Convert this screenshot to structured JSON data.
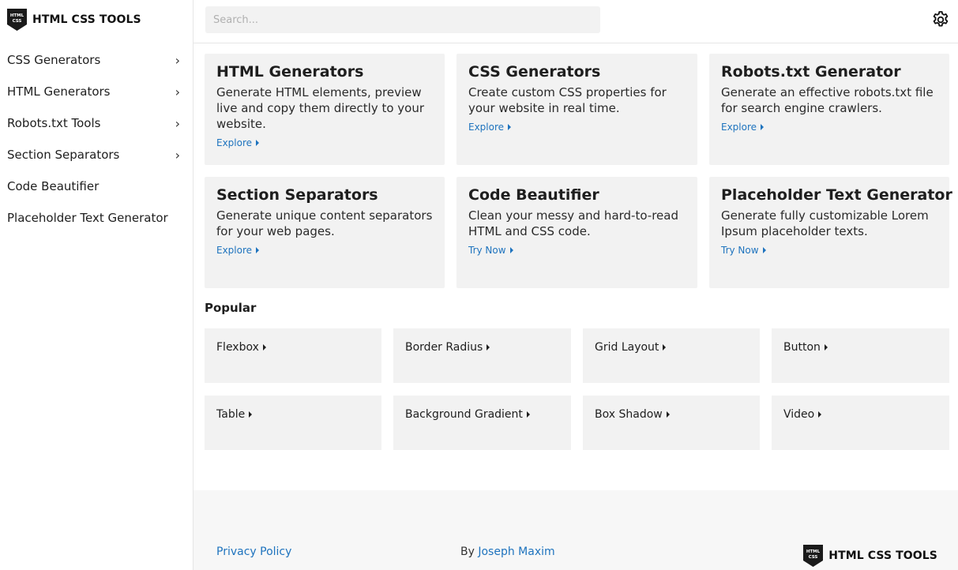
{
  "brand": {
    "logo_top": "HTML",
    "logo_bottom": "CSS",
    "name": "HTML CSS TOOLS"
  },
  "sidebar": {
    "items": [
      {
        "label": "CSS Generators",
        "chevron": "›"
      },
      {
        "label": "HTML Generators",
        "chevron": "›"
      },
      {
        "label": "Robots.txt Tools",
        "chevron": "›"
      },
      {
        "label": "Section Separators",
        "chevron": "›"
      },
      {
        "label": "Code Beautifier",
        "chevron": ""
      },
      {
        "label": "Placeholder Text Generator",
        "chevron": ""
      }
    ]
  },
  "header": {
    "search_placeholder": "Search...",
    "settings_icon": "gear-icon"
  },
  "cards": [
    {
      "title": "HTML Generators",
      "desc": "Generate HTML elements, preview live and copy them directly to your website.",
      "link": "Explore"
    },
    {
      "title": "CSS Generators",
      "desc": "Create custom CSS properties for your website in real time.",
      "link": "Explore"
    },
    {
      "title": "Robots.txt Generator",
      "desc": "Generate an effective robots.txt file for search engine crawlers.",
      "link": "Explore"
    },
    {
      "title": "Section Separators",
      "desc": "Generate unique content separators for your web pages.",
      "link": "Explore"
    },
    {
      "title": "Code Beautifier",
      "desc": "Clean your messy and hard-to-read HTML and CSS code.",
      "link": "Try Now"
    },
    {
      "title": "Placeholder Text Generator",
      "desc": "Generate fully customizable Lorem Ipsum placeholder texts.",
      "link": "Try Now"
    }
  ],
  "popular": {
    "heading": "Popular",
    "items": [
      "Flexbox",
      "Border Radius",
      "Grid Layout",
      "Button",
      "Table",
      "Background Gradient",
      "Box Shadow",
      "Video"
    ]
  },
  "footer": {
    "privacy": "Privacy Policy",
    "by_prefix": "By",
    "author": "Joseph Maxim",
    "brand_name": "HTML CSS TOOLS"
  },
  "colors": {
    "accent_link": "#1e73be",
    "card_bg": "#f2f2f2",
    "footer_bg": "#f7f7f7"
  }
}
